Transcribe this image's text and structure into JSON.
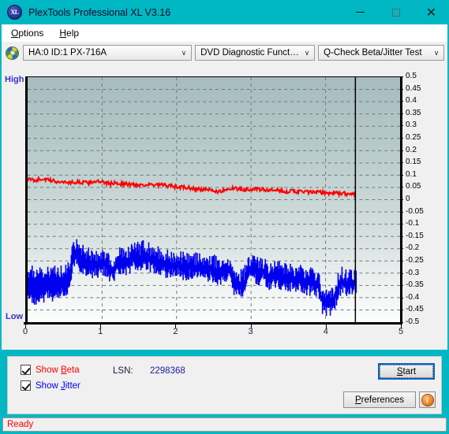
{
  "window": {
    "title": "PlexTools Professional XL V3.16",
    "app_icon": "xl-disc-icon",
    "minimize": "minimize-icon",
    "maximize": "maximize-icon",
    "close": "close-icon",
    "titlebar_color": "#00b7c3"
  },
  "menu": {
    "items": [
      {
        "label": "Options",
        "accel": "O"
      },
      {
        "label": "Help",
        "accel": "H"
      }
    ]
  },
  "toolbar": {
    "drive_icon": "disc-icon",
    "drive_combo": {
      "value": "HA:0 ID:1  PX-716A",
      "caret": "∨"
    },
    "function_combo": {
      "value": "DVD Diagnostic Functions",
      "caret": "∨"
    },
    "test_combo": {
      "value": "Q-Check Beta/Jitter Test",
      "caret": "∨"
    }
  },
  "chart_labels": {
    "high": "High",
    "low": "Low"
  },
  "controls": {
    "show_beta": {
      "label_pre": "Show ",
      "label_accel": "B",
      "label_post": "eta",
      "checked": true,
      "color": "#ff0000"
    },
    "show_jitter": {
      "label_pre": "Show ",
      "label_accel": "J",
      "label_post": "itter",
      "checked": true,
      "color": "#0000ee"
    },
    "lsn_label": "LSN:",
    "lsn_value": "2298368",
    "start_button": {
      "label_pre": "",
      "accel": "S",
      "label_post": "tart"
    },
    "preferences_button": {
      "accel": "P",
      "label_post": "references"
    },
    "info_button": {
      "glyph": "i",
      "name": "info-icon"
    }
  },
  "status": {
    "text": "Ready",
    "color": "#ff0000"
  },
  "chart_data": {
    "type": "line",
    "title": "Q-Check Beta/Jitter Test",
    "xlabel": "",
    "ylabel": "",
    "xlim": [
      0,
      5
    ],
    "ylim": [
      -0.5,
      0.5
    ],
    "xticks": [
      0,
      1,
      2,
      3,
      4,
      5
    ],
    "yticks": [
      0.5,
      0.45,
      0.4,
      0.35,
      0.3,
      0.25,
      0.2,
      0.15,
      0.1,
      0.05,
      0,
      -0.05,
      -0.1,
      -0.15,
      -0.2,
      -0.25,
      -0.3,
      -0.35,
      -0.4,
      -0.45,
      -0.5
    ],
    "ytick_labels": [
      "0.5",
      "0.45",
      "0.4",
      "0.35",
      "0.3",
      "0.25",
      "0.2",
      "0.15",
      "0.1",
      "0.05",
      "0",
      "-0.05",
      "-0.1",
      "-0.15",
      "-0.2",
      "-0.25",
      "-0.3",
      "-0.35",
      "-0.4",
      "-0.45",
      "-0.5"
    ],
    "grid": true,
    "grid_style": "dashed",
    "legend": [
      "Show Beta",
      "Show Jitter"
    ],
    "data_end_x": 4.4,
    "marker_line_x": 4.4,
    "series": [
      {
        "name": "Beta",
        "color": "#ff0000",
        "kind": "line",
        "x": [
          0.0,
          0.1,
          0.2,
          0.3,
          0.4,
          0.5,
          0.6,
          0.7,
          0.8,
          0.9,
          1.0,
          1.1,
          1.2,
          1.3,
          1.4,
          1.5,
          1.6,
          1.7,
          1.8,
          1.9,
          2.0,
          2.1,
          2.2,
          2.3,
          2.4,
          2.5,
          2.6,
          2.65,
          2.7,
          2.8,
          2.9,
          3.0,
          3.1,
          3.2,
          3.3,
          3.4,
          3.5,
          3.6,
          3.7,
          3.8,
          3.9,
          4.0,
          4.1,
          4.2,
          4.3,
          4.4
        ],
        "y": [
          0.082,
          0.08,
          0.086,
          0.078,
          0.074,
          0.072,
          0.07,
          0.072,
          0.068,
          0.076,
          0.07,
          0.066,
          0.068,
          0.064,
          0.062,
          0.06,
          0.062,
          0.058,
          0.06,
          0.056,
          0.052,
          0.05,
          0.046,
          0.042,
          0.04,
          0.036,
          0.032,
          0.044,
          0.046,
          0.044,
          0.042,
          0.044,
          0.042,
          0.04,
          0.038,
          0.036,
          0.034,
          0.034,
          0.032,
          0.03,
          0.03,
          0.028,
          0.026,
          0.026,
          0.024,
          0.022
        ]
      },
      {
        "name": "Jitter",
        "color": "#0000ee",
        "kind": "band",
        "x": [
          0.0,
          0.05,
          0.1,
          0.15,
          0.2,
          0.25,
          0.3,
          0.35,
          0.4,
          0.45,
          0.5,
          0.55,
          0.6,
          0.62,
          0.65,
          0.7,
          0.75,
          0.8,
          0.85,
          0.9,
          0.95,
          1.0,
          1.05,
          1.1,
          1.15,
          1.2,
          1.25,
          1.3,
          1.35,
          1.4,
          1.45,
          1.5,
          1.55,
          1.6,
          1.65,
          1.7,
          1.75,
          1.8,
          1.85,
          1.9,
          1.95,
          2.0,
          2.05,
          2.1,
          2.15,
          2.2,
          2.25,
          2.3,
          2.35,
          2.4,
          2.45,
          2.5,
          2.55,
          2.6,
          2.65,
          2.7,
          2.75,
          2.8,
          2.85,
          2.9,
          2.95,
          3.0,
          3.05,
          3.1,
          3.15,
          3.2,
          3.25,
          3.3,
          3.35,
          3.4,
          3.45,
          3.5,
          3.55,
          3.6,
          3.65,
          3.7,
          3.75,
          3.8,
          3.85,
          3.9,
          3.95,
          4.0,
          4.05,
          4.1,
          4.15,
          4.2,
          4.25,
          4.3,
          4.35,
          4.4
        ],
        "y_upper": [
          -0.3,
          -0.29,
          -0.31,
          -0.3,
          -0.305,
          -0.295,
          -0.3,
          -0.29,
          -0.295,
          -0.29,
          -0.285,
          -0.28,
          -0.2,
          -0.178,
          -0.185,
          -0.2,
          -0.215,
          -0.21,
          -0.23,
          -0.225,
          -0.23,
          -0.225,
          -0.22,
          -0.255,
          -0.25,
          -0.23,
          -0.215,
          -0.21,
          -0.22,
          -0.195,
          -0.19,
          -0.2,
          -0.185,
          -0.195,
          -0.21,
          -0.205,
          -0.215,
          -0.22,
          -0.23,
          -0.228,
          -0.232,
          -0.23,
          -0.235,
          -0.24,
          -0.238,
          -0.235,
          -0.24,
          -0.245,
          -0.25,
          -0.248,
          -0.245,
          -0.25,
          -0.255,
          -0.26,
          -0.255,
          -0.25,
          -0.3,
          -0.305,
          -0.31,
          -0.3,
          -0.25,
          -0.245,
          -0.25,
          -0.26,
          -0.255,
          -0.275,
          -0.28,
          -0.27,
          -0.275,
          -0.28,
          -0.285,
          -0.29,
          -0.288,
          -0.292,
          -0.29,
          -0.295,
          -0.3,
          -0.3,
          -0.305,
          -0.31,
          -0.38,
          -0.385,
          -0.39,
          -0.38,
          -0.33,
          -0.3,
          -0.305,
          -0.31,
          -0.305,
          -0.3
        ],
        "y_lower": [
          -0.38,
          -0.4,
          -0.42,
          -0.395,
          -0.41,
          -0.385,
          -0.4,
          -0.39,
          -0.385,
          -0.38,
          -0.375,
          -0.37,
          -0.27,
          -0.255,
          -0.265,
          -0.285,
          -0.295,
          -0.29,
          -0.3,
          -0.298,
          -0.3,
          -0.295,
          -0.29,
          -0.32,
          -0.315,
          -0.3,
          -0.29,
          -0.285,
          -0.295,
          -0.27,
          -0.262,
          -0.275,
          -0.258,
          -0.268,
          -0.285,
          -0.28,
          -0.29,
          -0.292,
          -0.3,
          -0.298,
          -0.302,
          -0.3,
          -0.305,
          -0.31,
          -0.308,
          -0.305,
          -0.31,
          -0.315,
          -0.32,
          -0.318,
          -0.315,
          -0.32,
          -0.325,
          -0.33,
          -0.325,
          -0.32,
          -0.37,
          -0.375,
          -0.38,
          -0.37,
          -0.32,
          -0.315,
          -0.32,
          -0.33,
          -0.325,
          -0.345,
          -0.35,
          -0.34,
          -0.345,
          -0.35,
          -0.355,
          -0.36,
          -0.358,
          -0.362,
          -0.36,
          -0.365,
          -0.37,
          -0.37,
          -0.375,
          -0.38,
          -0.45,
          -0.455,
          -0.46,
          -0.45,
          -0.4,
          -0.368,
          -0.372,
          -0.378,
          -0.372,
          -0.368
        ]
      }
    ]
  }
}
